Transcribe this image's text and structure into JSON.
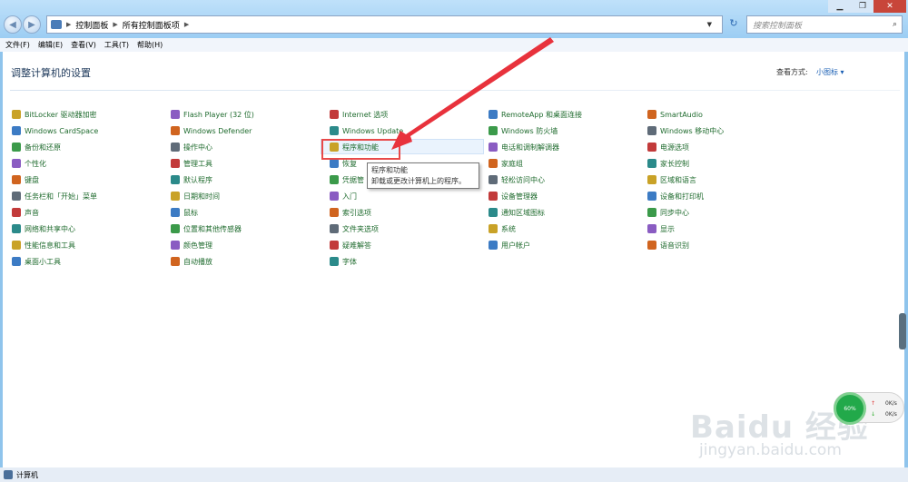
{
  "window": {
    "title": "控制面板"
  },
  "addressbar": {
    "crumb1": "控制面板",
    "crumb2": "所有控制面板项"
  },
  "search": {
    "placeholder": "搜索控制面板"
  },
  "menu": [
    "文件(F)",
    "编辑(E)",
    "查看(V)",
    "工具(T)",
    "帮助(H)"
  ],
  "page": {
    "title": "调整计算机的设置",
    "viewby_label": "查看方式:",
    "viewby_value": "小图标"
  },
  "columns": [
    [
      "BitLocker 驱动器加密",
      "Windows CardSpace",
      "备份和还原",
      "个性化",
      "键盘",
      "任务栏和「开始」菜单",
      "声音",
      "网络和共享中心",
      "性能信息和工具",
      "桌面小工具"
    ],
    [
      "Flash Player (32 位)",
      "Windows Defender",
      "操作中心",
      "管理工具",
      "默认程序",
      "日期和时间",
      "鼠标",
      "位置和其他传感器",
      "颜色管理",
      "自动播放"
    ],
    [
      "Internet 选项",
      "Windows Update",
      "程序和功能",
      "恢复",
      "凭据管",
      "入门",
      "索引选项",
      "文件夹选项",
      "疑难解答",
      "字体"
    ],
    [
      "RemoteApp 和桌面连接",
      "Windows 防火墙",
      "电话和调制解调器",
      "家庭组",
      "轻松访问中心",
      "设备管理器",
      "通知区域图标",
      "系统",
      "用户帐户"
    ],
    [
      "SmartAudio",
      "Windows 移动中心",
      "电源选项",
      "家长控制",
      "区域和语言",
      "设备和打印机",
      "同步中心",
      "显示",
      "语音识别"
    ]
  ],
  "tooltip": {
    "title": "程序和功能",
    "desc": "卸载或更改计算机上的程序。"
  },
  "statusbar": {
    "text": "计算机"
  },
  "widget": {
    "percent": "60%",
    "up": "0K/s",
    "down": "0K/s"
  },
  "watermark": {
    "logo": "Baidu 经验",
    "url": "jingyan.baidu.com"
  },
  "colors": {
    "link": "#1f6b2e",
    "title": "#1e395b",
    "highlight_box": "#e84a4a",
    "arrow": "#e8323c"
  },
  "icons": [
    "back-icon",
    "forward-icon",
    "control-panel-icon",
    "refresh-icon",
    "search-icon",
    "minimize-icon",
    "maximize-icon",
    "close-icon"
  ]
}
